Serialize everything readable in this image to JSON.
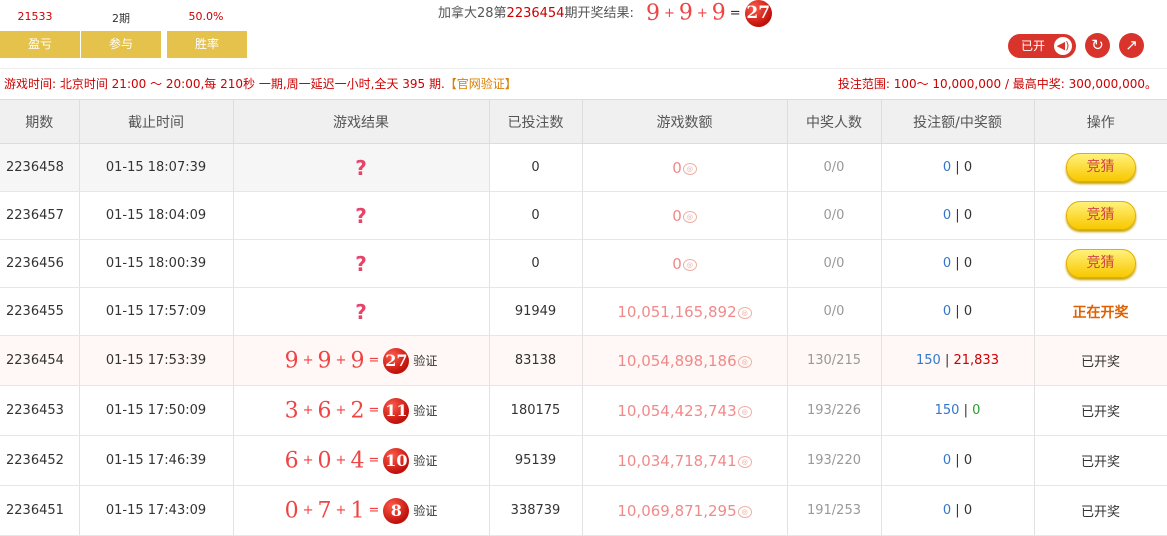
{
  "stats": {
    "profit": "21533",
    "participate": "2期",
    "winrate": "50.0%"
  },
  "top_buttons": {
    "profit_label": "盈亏",
    "participate_label": "参与",
    "winrate_label": "胜率"
  },
  "headline": {
    "prefix": "加拿大28第",
    "issue": "2236454",
    "suffix": "期开奖结果:",
    "n1": "9",
    "n2": "9",
    "n3": "9",
    "plus": "+",
    "eq": "=",
    "sum": "27"
  },
  "controls": {
    "open_label": "已开",
    "speaker_icon": "◀)",
    "refresh_icon": "↻",
    "trend_icon": "↗"
  },
  "info": {
    "text": "游戏时间: 北京时间 21:00 ～ 20:00,每 210秒 一期,周一延迟一小时,全天 395 期.",
    "link": "【官网验证】",
    "range": "投注范围: 100～ 10,000,000 / 最高中奖: 300,000,000。"
  },
  "columns": [
    "期数",
    "截止时间",
    "游戏结果",
    "已投注数",
    "游戏数额",
    "中奖人数",
    "投注额/中奖额",
    "操作"
  ],
  "rows": [
    {
      "issue": "2236458",
      "time": "01-15 18:07:39",
      "result": "?",
      "bets": "0",
      "amount": "0",
      "winners": "0/0",
      "bet_amt": "0",
      "win_amt": "0",
      "action": "竞猜"
    },
    {
      "issue": "2236457",
      "time": "01-15 18:04:09",
      "result": "?",
      "bets": "0",
      "amount": "0",
      "winners": "0/0",
      "bet_amt": "0",
      "win_amt": "0",
      "action": "竞猜"
    },
    {
      "issue": "2236456",
      "time": "01-15 18:00:39",
      "result": "?",
      "bets": "0",
      "amount": "0",
      "winners": "0/0",
      "bet_amt": "0",
      "win_amt": "0",
      "action": "竞猜"
    },
    {
      "issue": "2236455",
      "time": "01-15 17:57:09",
      "result": "?",
      "bets": "91949",
      "amount": "10,051,165,892",
      "winners": "0/0",
      "bet_amt": "0",
      "win_amt": "0",
      "action": "正在开奖"
    },
    {
      "issue": "2236454",
      "time": "01-15 17:53:39",
      "n1": "9",
      "n2": "9",
      "n3": "9",
      "sum": "27",
      "verify": "验证",
      "bets": "83138",
      "amount": "10,054,898,186",
      "winners": "130/215",
      "bet_amt": "150",
      "win_amt": "21,833",
      "action": "已开奖"
    },
    {
      "issue": "2236453",
      "time": "01-15 17:50:09",
      "n1": "3",
      "n2": "6",
      "n3": "2",
      "sum": "11",
      "verify": "验证",
      "bets": "180175",
      "amount": "10,054,423,743",
      "winners": "193/226",
      "bet_amt": "150",
      "win_amt": "0",
      "action": "已开奖"
    },
    {
      "issue": "2236452",
      "time": "01-15 17:46:39",
      "n1": "6",
      "n2": "0",
      "n3": "4",
      "sum": "10",
      "verify": "验证",
      "bets": "95139",
      "amount": "10,034,718,741",
      "winners": "193/220",
      "bet_amt": "0",
      "win_amt": "0",
      "action": "已开奖"
    },
    {
      "issue": "2236451",
      "time": "01-15 17:43:09",
      "n1": "0",
      "n2": "7",
      "n3": "1",
      "sum": "8",
      "verify": "验证",
      "bets": "338739",
      "amount": "10,069,871,295",
      "winners": "191/253",
      "bet_amt": "0",
      "win_amt": "0",
      "action": "已开奖"
    }
  ],
  "colors": {
    "accent_red": "#d9342b",
    "gold": "#e4c24c",
    "number_red": "#e44"
  }
}
